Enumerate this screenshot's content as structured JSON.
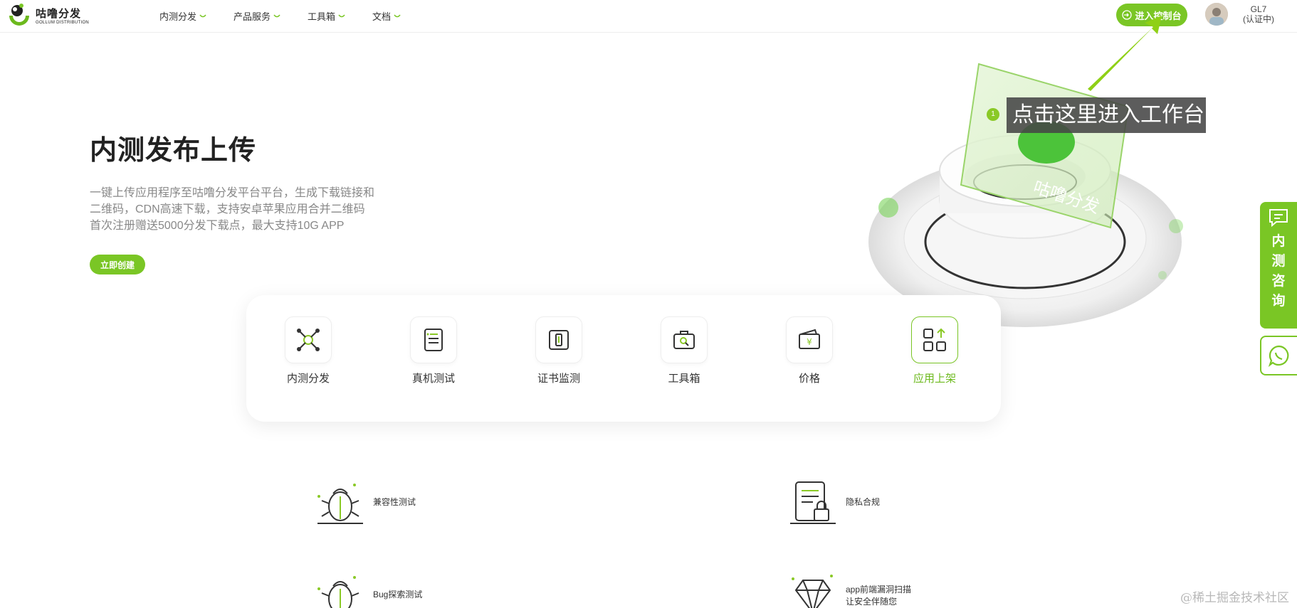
{
  "header": {
    "logo_cn": "咕噜分发",
    "logo_en": "GOLLUM DISTRIBUTION",
    "nav": [
      "内测分发",
      "产品服务",
      "工具箱",
      "文档"
    ],
    "console_label": "进入控制台",
    "user_name": "GL7",
    "user_status": "(认证中)"
  },
  "hero": {
    "title": "内测发布上传",
    "desc_lines": [
      "一键上传应用程序至咕噜分发平台平台，生成下载链接和",
      "二维码，CDN高速下载，支持安卓苹果应用合并二维码",
      "首次注册赠送5000分发下载点，最大支持10G APP"
    ],
    "create_label": "立即创建"
  },
  "illustration": {
    "brand_text": "咕噜分发"
  },
  "tooltip": {
    "step": "1",
    "text": "点击这里进入工作台"
  },
  "features": [
    {
      "label": "内测分发",
      "icon": "distribution-icon",
      "active": false
    },
    {
      "label": "真机测试",
      "icon": "device-test-icon",
      "active": false
    },
    {
      "label": "证书监测",
      "icon": "certificate-icon",
      "active": false
    },
    {
      "label": "工具箱",
      "icon": "toolbox-icon",
      "active": false
    },
    {
      "label": "价格",
      "icon": "price-icon",
      "active": false
    },
    {
      "label": "应用上架",
      "icon": "app-publish-icon",
      "active": true
    }
  ],
  "services": [
    {
      "label": "兼容性测试",
      "icon": "bug-icon"
    },
    {
      "label": "隐私合规",
      "icon": "privacy-lock-icon"
    },
    {
      "label": "Bug探索测试",
      "icon": "bug-icon"
    },
    {
      "label_lines": [
        "app前端漏洞扫描",
        "让安全伴随您"
      ],
      "icon": "diamond-icon"
    }
  ],
  "side": {
    "consult_chars": [
      "内",
      "测",
      "咨",
      "询"
    ]
  },
  "watermark": "@稀土掘金技术社区",
  "colors": {
    "brand_green": "#7ac625",
    "tooltip_bg": "#464646"
  }
}
